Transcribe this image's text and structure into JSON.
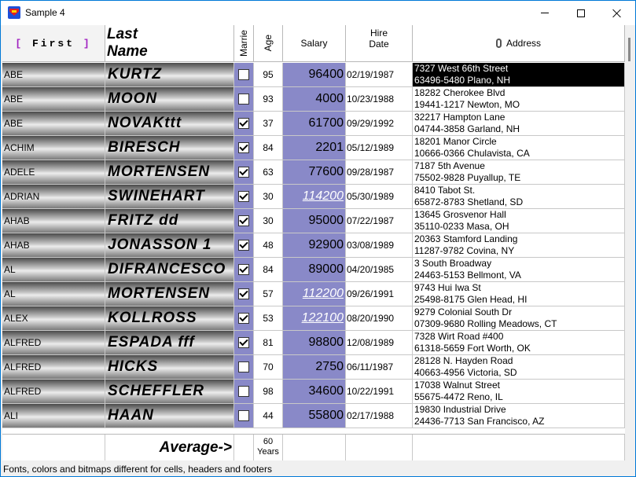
{
  "window": {
    "title": "Sample 4"
  },
  "headers": {
    "first": "First",
    "first_open": "[",
    "first_close": "]",
    "last_line1": "Last",
    "last_line2": "Name",
    "married": "Marrie",
    "age": "Age",
    "salary": "Salary",
    "hire_line1": "Hire",
    "hire_line2": "Date",
    "address": "Address"
  },
  "rows": [
    {
      "first": "ABE",
      "last": "KURTZ",
      "married": false,
      "age": "95",
      "salary": "96400",
      "hire": "02/19/1987",
      "addr1": "7327 West 66th Street",
      "addr2": "63496-5480 Plano, NH",
      "selected": true,
      "highlight": false
    },
    {
      "first": "ABE",
      "last": "MOON",
      "married": false,
      "age": "93",
      "salary": "4000",
      "hire": "10/23/1988",
      "addr1": "18282 Cherokee Blvd",
      "addr2": "19441-1217 Newton, MO",
      "selected": false,
      "highlight": false
    },
    {
      "first": "ABE",
      "last": "NOVAKttt",
      "married": true,
      "age": "37",
      "salary": "61700",
      "hire": "09/29/1992",
      "addr1": "32217 Hampton Lane",
      "addr2": "04744-3858 Garland, NH",
      "selected": false,
      "highlight": false
    },
    {
      "first": "ACHIM",
      "last": "BIRESCH",
      "married": true,
      "age": "84",
      "salary": "2201",
      "hire": "05/12/1989",
      "addr1": "18201 Manor Circle",
      "addr2": "10666-0366 Chulavista, CA",
      "selected": false,
      "highlight": false
    },
    {
      "first": "ADELE",
      "last": "MORTENSEN",
      "married": true,
      "age": "63",
      "salary": "77600",
      "hire": "09/28/1987",
      "addr1": "7187 5th Avenue",
      "addr2": "75502-9828 Puyallup, TE",
      "selected": false,
      "highlight": false
    },
    {
      "first": "ADRIAN",
      "last": "SWINEHART",
      "married": true,
      "age": "30",
      "salary": "114200",
      "hire": "05/30/1989",
      "addr1": "8410 Tabot St.",
      "addr2": "65872-8783 Shetland, SD",
      "selected": false,
      "highlight": true
    },
    {
      "first": "AHAB",
      "last": "FRITZ       dd",
      "married": true,
      "age": "30",
      "salary": "95000",
      "hire": "07/22/1987",
      "addr1": "13645 Grosvenor Hall",
      "addr2": "35110-0233 Masa, OH",
      "selected": false,
      "highlight": false
    },
    {
      "first": "AHAB",
      "last": "JONASSON    1",
      "married": true,
      "age": "48",
      "salary": "92900",
      "hire": "03/08/1989",
      "addr1": "20363 Stamford Landing",
      "addr2": "11287-9782 Covina, NY",
      "selected": false,
      "highlight": false
    },
    {
      "first": "AL",
      "last": "DIFRANCESCO",
      "married": true,
      "age": "84",
      "salary": "89000",
      "hire": "04/20/1985",
      "addr1": "3 South Broadway",
      "addr2": "24463-5153 Bellmont, VA",
      "selected": false,
      "highlight": false
    },
    {
      "first": "AL",
      "last": "MORTENSEN",
      "married": true,
      "age": "57",
      "salary": "112200",
      "hire": "09/26/1991",
      "addr1": "9743 Hui Iwa St",
      "addr2": "25498-8175 Glen Head, HI",
      "selected": false,
      "highlight": true
    },
    {
      "first": "ALEX",
      "last": "KOLLROSS",
      "married": true,
      "age": "53",
      "salary": "122100",
      "hire": "08/20/1990",
      "addr1": "9279 Colonial South Dr",
      "addr2": "07309-9680 Rolling Meadows, CT",
      "selected": false,
      "highlight": true
    },
    {
      "first": "ALFRED",
      "last": "ESPADA   fff",
      "married": true,
      "age": "81",
      "salary": "98800",
      "hire": "12/08/1989",
      "addr1": "7328 Wirt Road #400",
      "addr2": "61318-5659 Fort Worth, OK",
      "selected": false,
      "highlight": false
    },
    {
      "first": "ALFRED",
      "last": "HICKS",
      "married": false,
      "age": "70",
      "salary": "2750",
      "hire": "06/11/1987",
      "addr1": "28128 N. Hayden Road",
      "addr2": "40663-4956 Victoria, SD",
      "selected": false,
      "highlight": false
    },
    {
      "first": "ALFRED",
      "last": "SCHEFFLER",
      "married": false,
      "age": "98",
      "salary": "34600",
      "hire": "10/22/1991",
      "addr1": "17038 Walnut Street",
      "addr2": "55675-4472 Reno, IL",
      "selected": false,
      "highlight": false
    },
    {
      "first": "ALI",
      "last": "HAAN",
      "married": false,
      "age": "44",
      "salary": "55800",
      "hire": "02/17/1988",
      "addr1": "19830 Industrial Drive",
      "addr2": "24436-7713 San Francisco, AZ",
      "selected": false,
      "highlight": false
    }
  ],
  "footer": {
    "average_label": "Average->",
    "age_value": "60",
    "age_unit": "Years"
  },
  "status": "Fonts, colors and bitmaps different for cells, headers and footers",
  "icons": {
    "app": "superman-app-icon",
    "address_header": "paperclip-icon"
  },
  "colors": {
    "accent": "#8989c8",
    "selected": "#000000",
    "highlight_text": "#ffffff"
  }
}
